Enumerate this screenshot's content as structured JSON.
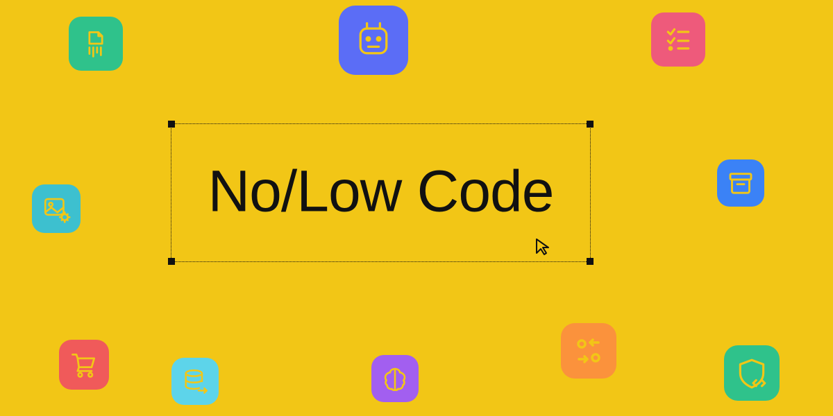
{
  "heading": "No/Low Code",
  "colors": {
    "background": "#f2c616",
    "selection": "#111111",
    "stroke_yellow": "#f2c616",
    "tiles": {
      "shred": "#2fc28b",
      "robot": "#5b6df6",
      "checklist": "#ee5a7b",
      "image": "#3dc0cf",
      "archive": "#3b82f6",
      "cart": "#f05a5a",
      "database": "#5dd4ea",
      "brain": "#a25ff0",
      "swap": "#fb923c",
      "shield": "#2fc28b"
    }
  },
  "tiles": [
    {
      "id": "shred",
      "icon": "shred-icon"
    },
    {
      "id": "robot",
      "icon": "robot-icon"
    },
    {
      "id": "checklist",
      "icon": "checklist-icon"
    },
    {
      "id": "image",
      "icon": "image-settings-icon"
    },
    {
      "id": "archive",
      "icon": "archive-box-icon"
    },
    {
      "id": "cart",
      "icon": "shopping-cart-icon"
    },
    {
      "id": "database",
      "icon": "database-export-icon"
    },
    {
      "id": "brain",
      "icon": "brain-icon"
    },
    {
      "id": "swap",
      "icon": "swap-icon"
    },
    {
      "id": "shield",
      "icon": "shield-code-icon"
    }
  ]
}
